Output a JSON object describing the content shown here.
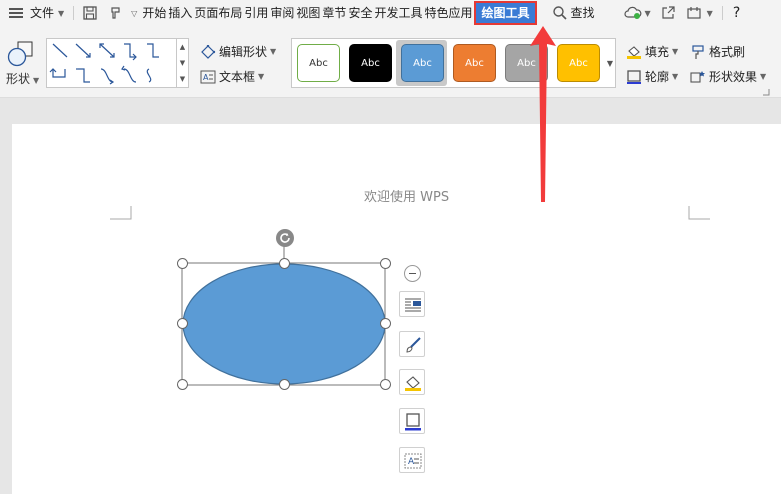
{
  "menubar": {
    "file_label": "文件",
    "tabs": [
      {
        "label": "开始"
      },
      {
        "label": "插入"
      },
      {
        "label": "页面布局"
      },
      {
        "label": "引用"
      },
      {
        "label": "审阅"
      },
      {
        "label": "视图"
      },
      {
        "label": "章节"
      },
      {
        "label": "安全"
      },
      {
        "label": "开发工具"
      },
      {
        "label": "特色应用"
      }
    ],
    "active_tab": "绘图工具",
    "search_label": "查找",
    "help_label": "?"
  },
  "ribbon": {
    "shape_label": "形状",
    "edit_shape_label": "编辑形状",
    "textbox_label": "文本框",
    "styles": [
      {
        "label": "Abc",
        "bg": "#ffffff",
        "border": "#70ad47",
        "text_color": "#333333"
      },
      {
        "label": "Abc",
        "bg": "#000000",
        "border": "#000000",
        "text_color": "#ffffff"
      },
      {
        "label": "Abc",
        "bg": "#5b9bd5",
        "border": "#41719c",
        "text_color": "#ffffff"
      },
      {
        "label": "Abc",
        "bg": "#ed7d31",
        "border": "#ae5a21",
        "text_color": "#ffffff"
      },
      {
        "label": "Abc",
        "bg": "#a5a5a5",
        "border": "#7c7c7c",
        "text_color": "#ffffff"
      },
      {
        "label": "Abc",
        "bg": "#ffc000",
        "border": "#bc8c00",
        "text_color": "#ffffff"
      }
    ],
    "fill_label": "填充",
    "outline_label": "轮廓",
    "format_painter_label": "格式刷",
    "shape_effects_label": "形状效果"
  },
  "document": {
    "header_text": "欢迎使用 WPS"
  },
  "colors": {
    "accent": "#3a7bd5",
    "highlight_red": "#e53935",
    "ellipse_fill": "#5b9bd5",
    "ellipse_stroke": "#41719c"
  }
}
